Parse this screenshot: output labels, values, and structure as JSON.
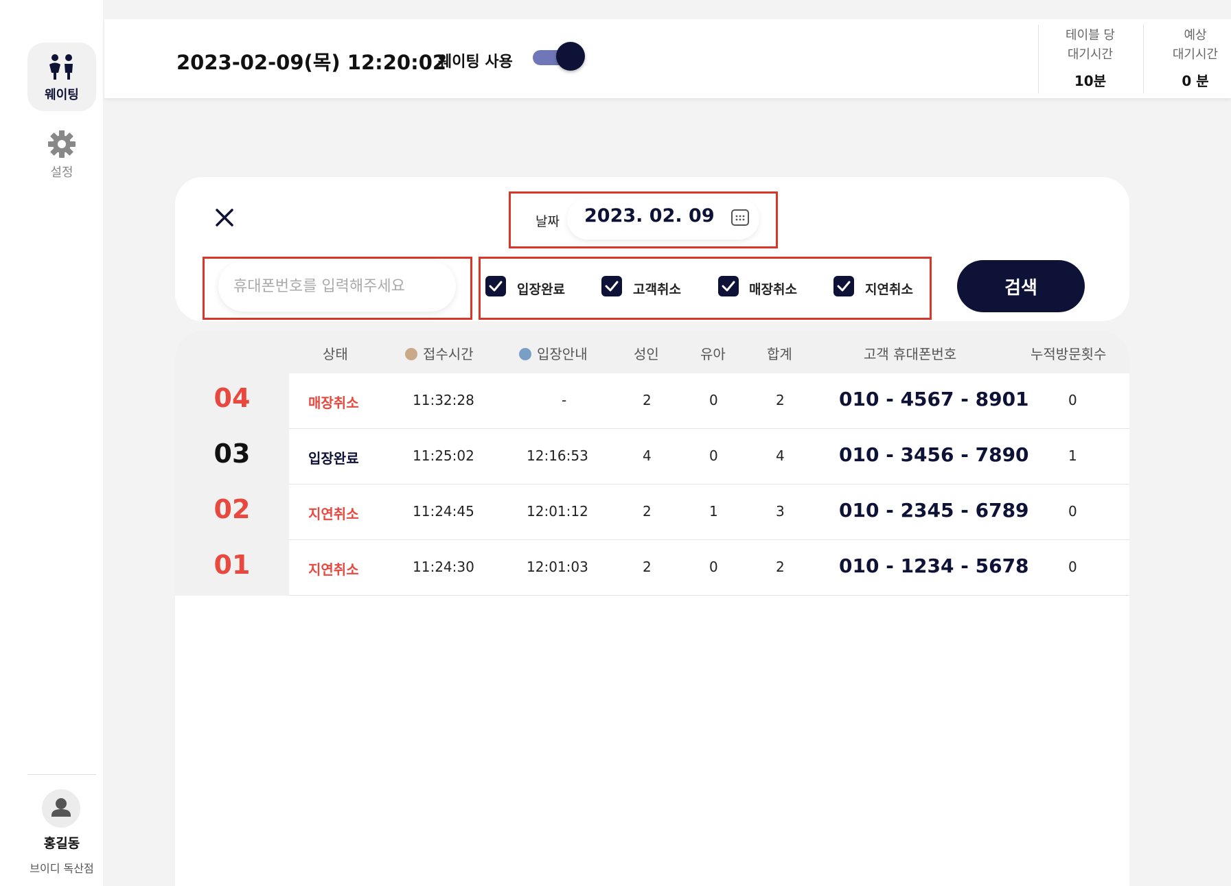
{
  "sidebar": {
    "waiting_label": "웨이팅",
    "settings_label": "설정",
    "user_name": "홍길동",
    "store_name": "브이디 독산점"
  },
  "header": {
    "datetime": "2023-02-09(목) 12:20:02",
    "waiting_toggle_label": "웨이팅 사용",
    "waiting_enabled": true,
    "stats": [
      {
        "title_line1": "테이블 당",
        "title_line2": "대기시간",
        "value": "10분"
      },
      {
        "title_line1": "예상",
        "title_line2": "대기시간",
        "value": "0 분"
      }
    ]
  },
  "search": {
    "date_label": "날짜",
    "date_value": "2023. 02. 09",
    "phone_placeholder": "휴대폰번호를 입력해주세요",
    "filters": [
      {
        "label": "입장완료",
        "checked": true
      },
      {
        "label": "고객취소",
        "checked": true
      },
      {
        "label": "매장취소",
        "checked": true
      },
      {
        "label": "지연취소",
        "checked": true
      }
    ],
    "search_button": "검색"
  },
  "table": {
    "headers": {
      "status": "상태",
      "received_time": "접수시간",
      "entry_notice": "입장안내",
      "adults": "성인",
      "infants": "유아",
      "total": "합계",
      "phone": "고객 휴대폰번호",
      "visits": "누적방문횟수"
    },
    "rows": [
      {
        "num": "04",
        "status": "매장취소",
        "received": "11:32:28",
        "entry": "-",
        "adults": "2",
        "infants": "0",
        "total": "2",
        "phone": "010 - 4567 - 8901",
        "visits": "0"
      },
      {
        "num": "03",
        "status": "입장완료",
        "received": "11:25:02",
        "entry": "12:16:53",
        "adults": "4",
        "infants": "0",
        "total": "4",
        "phone": "010 - 3456 - 7890",
        "visits": "1"
      },
      {
        "num": "02",
        "status": "지연취소",
        "received": "11:24:45",
        "entry": "12:01:12",
        "adults": "2",
        "infants": "1",
        "total": "3",
        "phone": "010 - 2345 - 6789",
        "visits": "0"
      },
      {
        "num": "01",
        "status": "지연취소",
        "received": "11:24:30",
        "entry": "12:01:03",
        "adults": "2",
        "infants": "0",
        "total": "2",
        "phone": "010 - 1234 - 5678",
        "visits": "0"
      }
    ]
  },
  "colors": {
    "navy": "#0e1236",
    "cancel_red": "#e8483e",
    "highlight_red": "#d9362b",
    "toggle_track": "#7077b8",
    "clock_received": "#c9a98a",
    "clock_entry": "#7a9fc6"
  },
  "icons": [
    "people-icon",
    "gear-icon",
    "close-icon",
    "calendar-icon",
    "check-icon",
    "clock-icon",
    "user-icon"
  ]
}
